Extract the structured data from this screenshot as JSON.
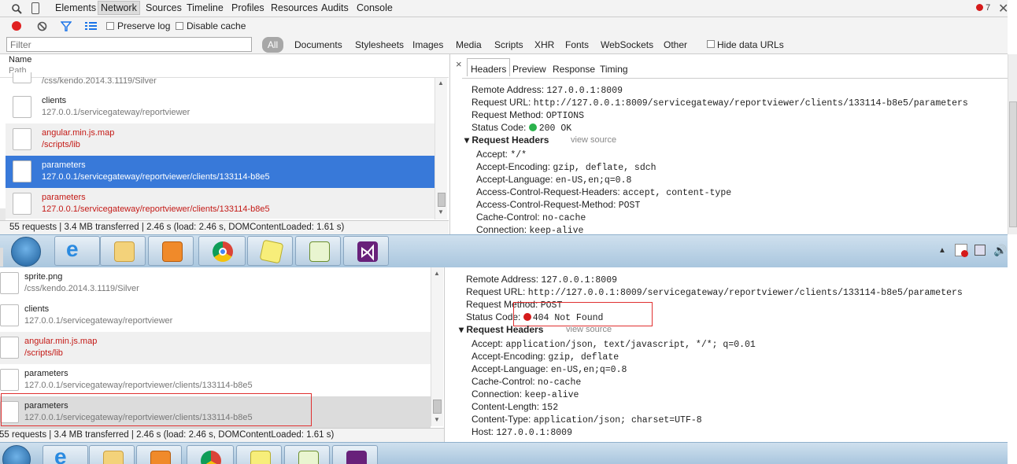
{
  "top_tabs": [
    "Elements",
    "Network",
    "Sources",
    "Timeline",
    "Profiles",
    "Resources",
    "Audits",
    "Console"
  ],
  "active_tab": "Network",
  "error_count": "7",
  "toolbar": {
    "preserve_log": "Preserve log",
    "disable_cache": "Disable cache"
  },
  "filter": {
    "placeholder": "Filter",
    "all": "All",
    "types": [
      "Documents",
      "Stylesheets",
      "Images",
      "Media",
      "Scripts",
      "XHR",
      "Fonts",
      "WebSockets",
      "Other"
    ],
    "hide_data_urls": "Hide data URLs"
  },
  "list_header": {
    "name": "Name",
    "path": "Path"
  },
  "top_requests": [
    {
      "name": "",
      "path": "/css/kendo.2014.3.1119/Silver"
    },
    {
      "name": "clients",
      "path": "127.0.0.1/servicegateway/reportviewer"
    },
    {
      "name": "angular.min.js.map",
      "path": "/scripts/lib"
    },
    {
      "name": "parameters",
      "path": "127.0.0.1/servicegateway/reportviewer/clients/133114-b8e5"
    },
    {
      "name": "parameters",
      "path": "127.0.0.1/servicegateway/reportviewer/clients/133114-b8e5"
    }
  ],
  "status_bar": "55 requests | 3.4 MB transferred | 2.46 s (load: 2.46 s, DOMContentLoaded: 1.61 s)",
  "detail_tabs": [
    "Headers",
    "Preview",
    "Response",
    "Timing"
  ],
  "top_detail": {
    "remote_address": {
      "k": "Remote Address:",
      "v": "127.0.0.1:8009"
    },
    "request_url": {
      "k": "Request URL:",
      "v": "http://127.0.0.1:8009/servicegateway/reportviewer/clients/133114-b8e5/parameters"
    },
    "request_method": {
      "k": "Request Method:",
      "v": "OPTIONS"
    },
    "status_code": {
      "k": "Status Code:",
      "v": "200 OK"
    },
    "request_headers_title": "Request Headers",
    "view_source": "view source",
    "headers": [
      {
        "k": "Accept:",
        "v": "*/*"
      },
      {
        "k": "Accept-Encoding:",
        "v": "gzip, deflate, sdch"
      },
      {
        "k": "Accept-Language:",
        "v": "en-US,en;q=0.8"
      },
      {
        "k": "Access-Control-Request-Headers:",
        "v": "accept, content-type"
      },
      {
        "k": "Access-Control-Request-Method:",
        "v": "POST"
      },
      {
        "k": "Cache-Control:",
        "v": "no-cache"
      },
      {
        "k": "Connection:",
        "v": "keep-alive"
      }
    ]
  },
  "bottom_requests": [
    {
      "name": "sprite.png",
      "path": "/css/kendo.2014.3.1119/Silver"
    },
    {
      "name": "clients",
      "path": "127.0.0.1/servicegateway/reportviewer"
    },
    {
      "name": "angular.min.js.map",
      "path": "/scripts/lib"
    },
    {
      "name": "parameters",
      "path": "127.0.0.1/servicegateway/reportviewer/clients/133114-b8e5"
    },
    {
      "name": "parameters",
      "path": "127.0.0.1/servicegateway/reportviewer/clients/133114-b8e5"
    }
  ],
  "bottom_detail": {
    "remote_address": {
      "k": "Remote Address:",
      "v": "127.0.0.1:8009"
    },
    "request_url": {
      "k": "Request URL:",
      "v": "http://127.0.0.1:8009/servicegateway/reportviewer/clients/133114-b8e5/parameters"
    },
    "request_method": {
      "k": "Request Method:",
      "v": "POST"
    },
    "status_code": {
      "k": "Status Code:",
      "v": "404 Not Found"
    },
    "request_headers_title": "Request Headers",
    "view_source": "view source",
    "headers": [
      {
        "k": "Accept:",
        "v": "application/json, text/javascript, */*; q=0.01"
      },
      {
        "k": "Accept-Encoding:",
        "v": "gzip, deflate"
      },
      {
        "k": "Accept-Language:",
        "v": "en-US,en;q=0.8"
      },
      {
        "k": "Cache-Control:",
        "v": "no-cache"
      },
      {
        "k": "Connection:",
        "v": "keep-alive"
      },
      {
        "k": "Content-Length:",
        "v": "152"
      },
      {
        "k": "Content-Type:",
        "v": "application/json; charset=UTF-8"
      },
      {
        "k": "Host:",
        "v": "127.0.0.1:8009"
      }
    ]
  },
  "taskbar_apps": [
    "start-orb",
    "internet-explorer",
    "file-explorer",
    "media-player",
    "chrome",
    "sticky-notes",
    "notepad-plus-plus",
    "visual-studio"
  ],
  "colors": {
    "selected_row": "#3879d9",
    "error_red": "#c41a16",
    "ok_green": "#2bb24c"
  }
}
